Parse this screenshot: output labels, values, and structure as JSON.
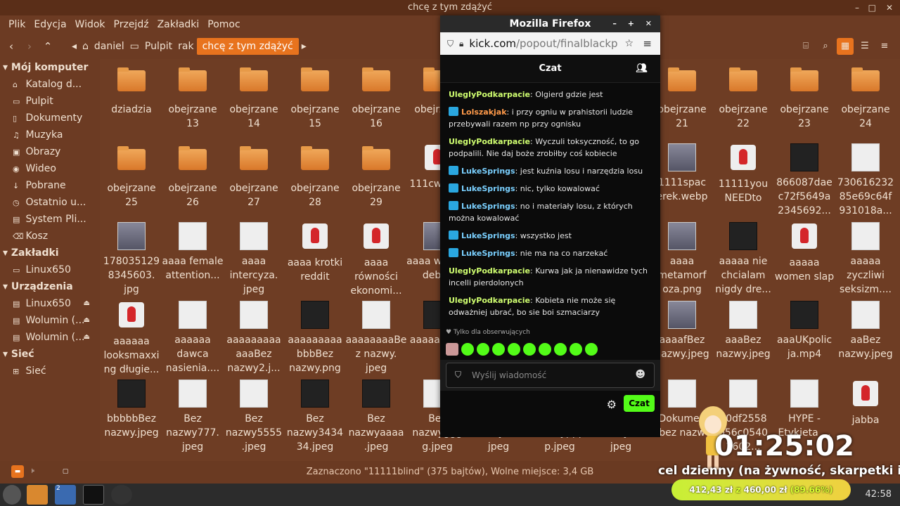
{
  "fm": {
    "title": "chcę z tym zdążyć",
    "menu": [
      "Plik",
      "Edycja",
      "Widok",
      "Przejdź",
      "Zakładki",
      "Pomoc"
    ],
    "crumbs": [
      "daniel",
      "Pulpit",
      "rak",
      "chcę z tym zdążyć"
    ],
    "sidebar": {
      "computer": "Mój komputer",
      "computer_items": [
        "Katalog d...",
        "Pulpit",
        "Dokumenty",
        "Muzyka",
        "Obrazy",
        "Wideo",
        "Pobrane",
        "Ostatnio u...",
        "System Pli...",
        "Kosz"
      ],
      "bookmarks": "Zakładki",
      "bookmark_items": [
        "Linux650"
      ],
      "devices": "Urządzenia",
      "device_items": [
        "Linux650",
        "Wolumin (...",
        "Wolumin (..."
      ],
      "network": "Sieć",
      "network_items": [
        "Sieć"
      ]
    },
    "files": [
      [
        "dziadzia",
        "obejrzane 13",
        "obejrzane 14",
        "obejrzane 15",
        "obejrzane 16",
        "obejrz 17",
        "",
        "",
        "",
        "obejrzane 21",
        "obejrzane 22",
        "obejrzane 23",
        "obejrzane 24"
      ],
      [
        "obejrzane 25",
        "obejrzane 26",
        "obejrzane 27",
        "obejrzane 28",
        "obejrzane 29",
        "111cw pols",
        "",
        "",
        "",
        "1111spac erek.webp",
        "11111you NEEDto",
        "866087dae c72f5649a 2345692...",
        "730616232 85e69c64f 931018a..."
      ],
      [
        "178035129 8345603. jpg",
        "aaaa female attention...",
        "aaaa intercyza. jpeg",
        "aaaa krotki reddit",
        "aaaa równości ekonomi...",
        "aaaa wa jaki debilk",
        "",
        "",
        "",
        "aaaa metamorf oza.png",
        "aaaaa nie chcialam nigdy dre...",
        "aaaaa women slap",
        "aaaaa zyczliwi seksizm...."
      ],
      [
        "aaaaaa looksmaxxi ng długie...",
        "aaaaaa dawca nasienia....",
        "aaaaaaaaa aaaBez nazwy2.j...",
        "aaaaaaaaa bbbBez nazwy.png",
        "aaaaaaaaBe z nazwy. jpeg",
        "aaaaaa b.p",
        "",
        "",
        "",
        "aaaafBez nazwy.jpeg",
        "aaaBez nazwy.jpeg",
        "aaaUKpolic ja.mp4",
        "aaBez nazwy.jpeg"
      ],
      [
        "bbbbbBez nazwy.jpeg",
        "Bez nazwy777. jpeg",
        "Bez nazwy5555 .jpeg",
        "Bez nazwy3434 34.jpeg",
        "Bez nazwyaaaa .jpeg",
        "Bez nazwyggg g.jpeg",
        "Bez nazwykkk. jpeg",
        "Bez nazwyppp p.jpeg",
        "Bez nazwyttt. jpeg",
        "Dokumen bez nazw",
        "20df2558 b56c0540 2602...",
        "HYPE - Etykieta ...",
        "jabba"
      ]
    ],
    "status": "Zaznaczono \"11111blind\" (375 bajtów), Wolne miejsce: 3,4 GB"
  },
  "firefox": {
    "title": "Mozilla Firefox",
    "url_host": "kick.com",
    "url_path": "/popout/finalblackpil",
    "chat_title": "Czat",
    "messages": [
      {
        "user": "UlegIyPodkarpacie",
        "color": "#d0ff70",
        "badge": false,
        "text": "Olgierd gdzie jest"
      },
      {
        "user": "Lolszakjak",
        "color": "#ff9a4a",
        "badge": true,
        "text": "i przy ogniu w prahistorii ludzie przebywali razem np przy ognisku"
      },
      {
        "user": "UlegIyPodkarpacie",
        "color": "#d0ff70",
        "badge": false,
        "text": "Wyczuli toksyczność, to go podpalili. Nie daj boże zrobiłby coś kobiecie"
      },
      {
        "user": "LukeSprings",
        "color": "#7ad0ff",
        "badge": true,
        "text": "jest kuźnia losu i narzędzia losu"
      },
      {
        "user": "LukeSprings",
        "color": "#7ad0ff",
        "badge": true,
        "text": "nic, tylko kowalować"
      },
      {
        "user": "LukeSprings",
        "color": "#7ad0ff",
        "badge": true,
        "text": "no i materiały losu, z których można kowalować"
      },
      {
        "user": "LukeSprings",
        "color": "#7ad0ff",
        "badge": true,
        "text": "wszystko jest"
      },
      {
        "user": "LukeSprings",
        "color": "#7ad0ff",
        "badge": true,
        "text": "nie ma na co narzekać"
      },
      {
        "user": "UlegIyPodkarpacie",
        "color": "#d0ff70",
        "badge": false,
        "text": "Kurwa jak ja nienawidze tych incelli pierdolonych"
      },
      {
        "user": "UlegIyPodkarpacie",
        "color": "#d0ff70",
        "badge": false,
        "text": "Kobieta nie może się odważniej ubrać, bo sie boi szmaciarzy"
      }
    ],
    "followers_only": "Tylko dla obserwujących",
    "input_placeholder": "Wyślij wiadomość",
    "send_label": "Czat"
  },
  "overlay": {
    "timer": "01:25:02",
    "goal_label": "cel dzienny (na żywność, skarpetki itp)",
    "goal_current": "412,43 zł",
    "goal_sep": "z",
    "goal_target": "460,00 zł",
    "goal_pct": "(89.66%)"
  },
  "taskbar": {
    "clock": "42:58",
    "firefox_count": "2"
  }
}
